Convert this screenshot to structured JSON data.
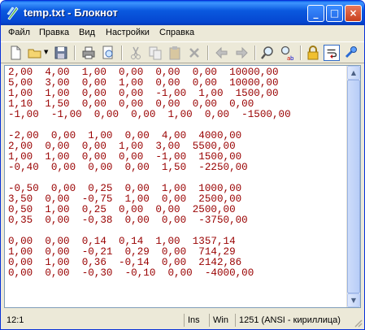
{
  "window": {
    "title": "temp.txt - Блокнот"
  },
  "titlebar_buttons": {
    "minimize": "_",
    "maximize": "□",
    "close": "×"
  },
  "menu": [
    "Файл",
    "Правка",
    "Вид",
    "Настройки",
    "Справка"
  ],
  "toolbar_icons": [
    "new-file-icon",
    "open-folder-icon",
    "save-icon",
    "print-icon",
    "print-preview-icon",
    "cut-icon",
    "copy-icon",
    "paste-icon",
    "delete-icon",
    "back-icon",
    "forward-icon",
    "find-icon",
    "replace-icon",
    "lock-icon",
    "word-wrap-icon",
    "settings-icon"
  ],
  "document": {
    "lines": [
      "2,00  4,00  1,00  0,00  0,00  0,00  10000,00",
      "5,00  3,00  0,00  1,00  0,00  0,00  10000,00",
      "1,00  1,00  0,00  0,00  -1,00  1,00  1500,00",
      "1,10  1,50  0,00  0,00  0,00  0,00  0,00",
      "-1,00  -1,00  0,00  0,00  1,00  0,00  -1500,00",
      "",
      "-2,00  0,00  1,00  0,00  4,00  4000,00",
      "2,00  0,00  0,00  1,00  3,00  5500,00",
      "1,00  1,00  0,00  0,00  -1,00  1500,00",
      "-0,40  0,00  0,00  0,00  1,50  -2250,00",
      "",
      "-0,50  0,00  0,25  0,00  1,00  1000,00",
      "3,50  0,00  -0,75  1,00  0,00  2500,00",
      "0,50  1,00  0,25  0,00  0,00  2500,00",
      "0,35  0,00  -0,38  0,00  0,00  -3750,00",
      "",
      "0,00  0,00  0,14  0,14  1,00  1357,14",
      "1,00  0,00  -0,21  0,29  0,00  714,29",
      "0,00  1,00  0,36  -0,14  0,00  2142,86",
      "0,00  0,00  -0,30  -0,10  0,00  -4000,00"
    ]
  },
  "status": {
    "position": "12:1",
    "mode": "Ins",
    "line_ending": "Win",
    "encoding": "1251  (ANSI - кириллица)"
  },
  "colors": {
    "text": "#990000",
    "titlebar": "#0a5ee8"
  }
}
